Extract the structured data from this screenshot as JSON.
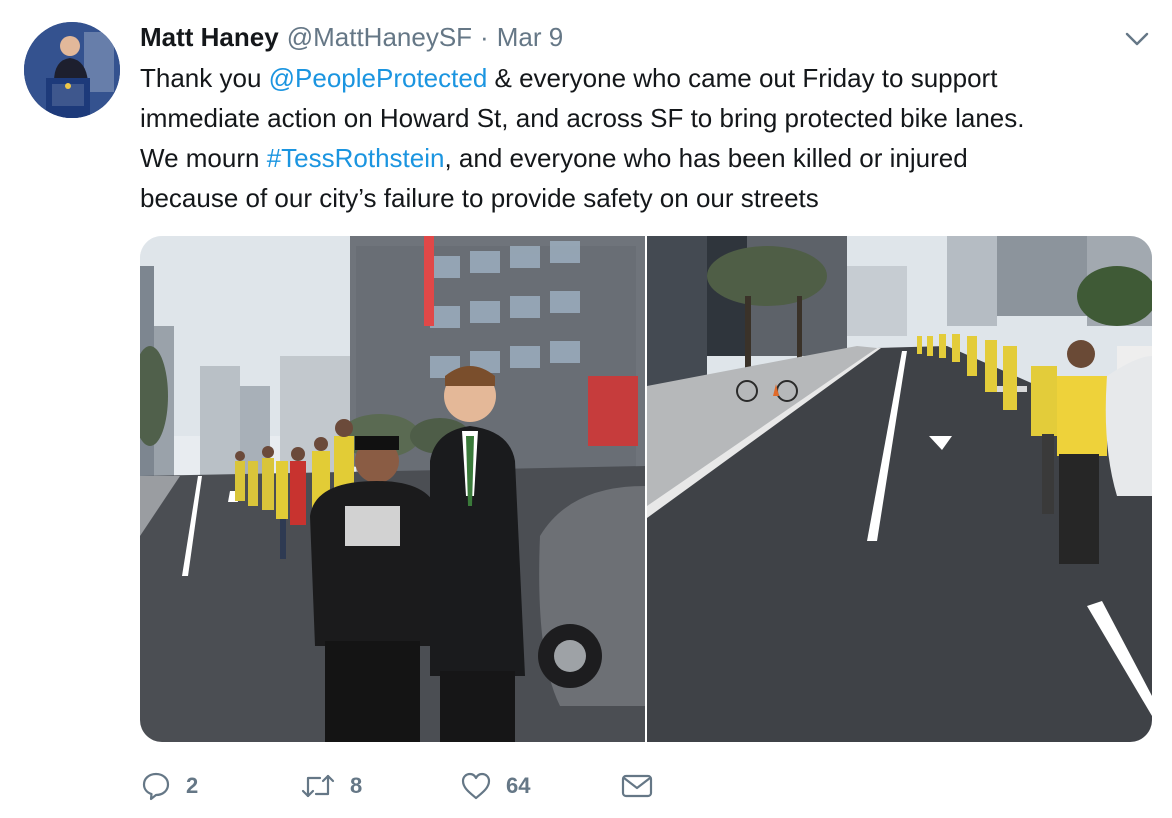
{
  "author": {
    "name": "Matt Haney",
    "handle": "@MattHaneySF",
    "separator": "·",
    "date": "Mar 9"
  },
  "tweet_text": {
    "line1_pre": "Thank you ",
    "line1_mention": "@PeopleProtected",
    "line1_post": " & everyone who came out Friday to support",
    "line2": "immediate action on Howard St, and across SF to bring protected bike lanes.",
    "line3_pre": "We mourn ",
    "line3_hashtag": "#TessRothstein",
    "line3_post": ", and everyone who has been killed or injured",
    "line4": "because of our city’s failure to provide safety on our streets"
  },
  "actions": {
    "replies": "2",
    "retweets": "8",
    "likes": "64"
  },
  "icons": {
    "caret": "chevron-down-icon",
    "reply": "reply-icon",
    "retweet": "retweet-icon",
    "like": "heart-icon",
    "dm": "direct-message-icon"
  },
  "colors": {
    "link": "#1b95e0",
    "secondary_text": "#657786",
    "primary_text": "#14171a"
  }
}
